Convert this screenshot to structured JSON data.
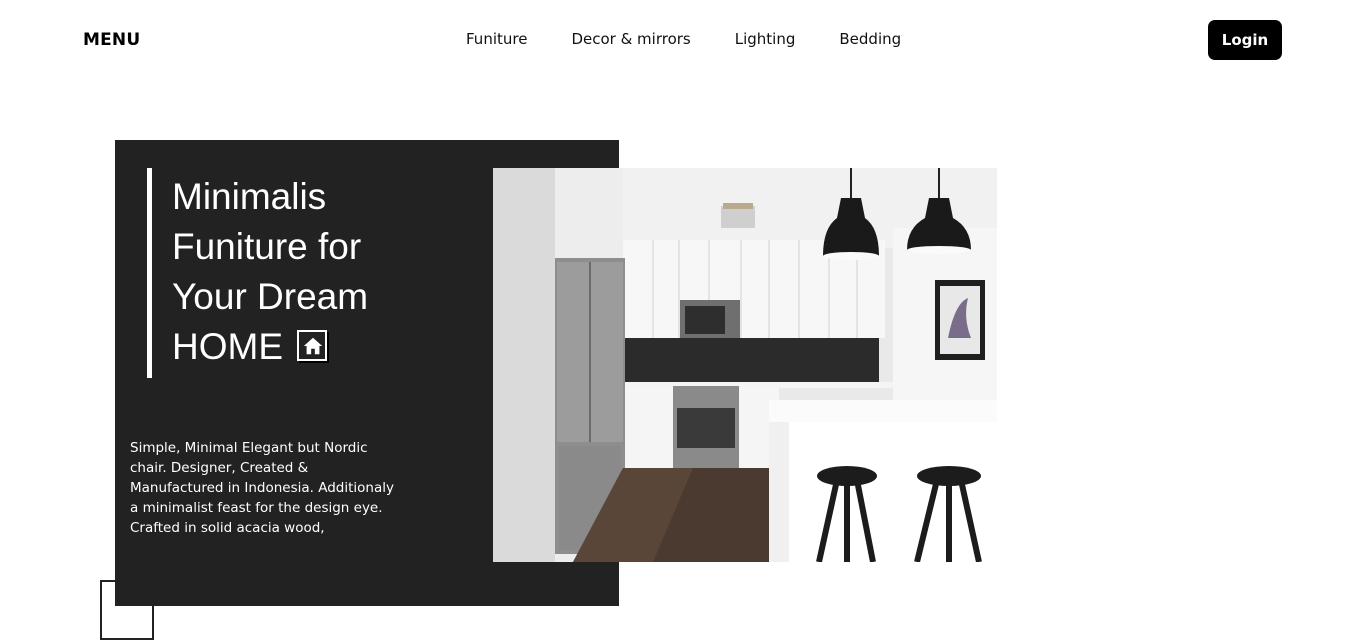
{
  "header": {
    "menu_label": "MENU",
    "nav": [
      "Funiture",
      "Decor & mirrors",
      "Lighting",
      "Bedding"
    ],
    "login_label": "Login"
  },
  "hero": {
    "title_lines": [
      "Minimalis",
      "Funiture for",
      "Your Dream",
      "HOME"
    ],
    "description": "Simple, Minimal Elegant but Nordic chair. Designer, Created & Manufactured in Indonesia. Additionaly a minimalist feast for the design eye. Crafted in solid acacia wood,",
    "icon": "home-icon"
  },
  "colors": {
    "panel": "#222222",
    "button": "#000000",
    "text_on_dark": "#ffffff"
  }
}
